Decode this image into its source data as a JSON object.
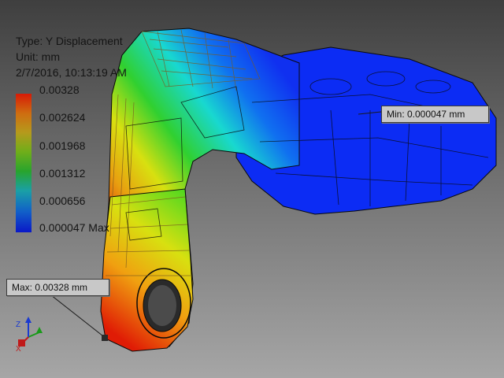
{
  "info": {
    "type_line": "Type: Y Displacement",
    "unit_line": "Unit: mm",
    "date_line": "2/7/2016, 10:13:19 AM"
  },
  "legend": {
    "labels": [
      "0.00328",
      "0.002624",
      "0.001968",
      "0.001312",
      "0.000656",
      "0.000047 Max"
    ],
    "colors": [
      "#d71b06",
      "#cf6c10",
      "#b59a1c",
      "#28a42d",
      "#1aa0a6",
      "#0a18c8"
    ]
  },
  "callouts": {
    "max_label": "Max: 0.00328 mm",
    "min_label": "Min: 0.000047 mm"
  },
  "triad": {
    "axes": [
      "Z",
      "X"
    ]
  }
}
